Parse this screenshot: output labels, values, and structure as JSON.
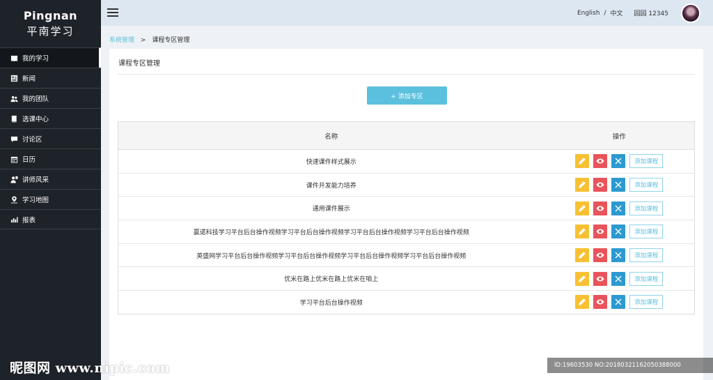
{
  "app": {
    "brand": "Pingnan",
    "brand_sub": "平南学习"
  },
  "sidebar": {
    "items": [
      {
        "label": "我的学习",
        "icon": "book-icon"
      },
      {
        "label": "新闻",
        "icon": "newspaper-icon"
      },
      {
        "label": "我的团队",
        "icon": "team-icon"
      },
      {
        "label": "选课中心",
        "icon": "book-icon"
      },
      {
        "label": "讨论区",
        "icon": "chat-icon"
      },
      {
        "label": "日历",
        "icon": "calendar-icon"
      },
      {
        "label": "讲师风采",
        "icon": "teacher-icon"
      },
      {
        "label": "学习地图",
        "icon": "map-pin-icon"
      },
      {
        "label": "报表",
        "icon": "bar-chart-icon"
      }
    ]
  },
  "header": {
    "lang_en": "English",
    "lang_sep": "/",
    "lang_zh": "中文",
    "user": "园园 12345"
  },
  "breadcrumb": {
    "parent": "系统管理",
    "separator": ">",
    "current": "课程专区管理"
  },
  "panel": {
    "title": "课程专区管理",
    "add_button": "+ 添加专区"
  },
  "table": {
    "headers": {
      "name": "名称",
      "ops": "操作"
    },
    "add_course_label": "添加课程",
    "rows": [
      {
        "name": "快速课件样式展示"
      },
      {
        "name": "课件开发能力培养"
      },
      {
        "name": "通用课件展示"
      },
      {
        "name": "赢诺科技学习平台后台操作视频学习平台后台操作视频学习平台后台操作视频学习平台后台操作视频"
      },
      {
        "name": "英盛网学习平台后台操作视频学习平台后台操作视频学习平台后台操作视频学习平台后台操作视频"
      },
      {
        "name": "优米在路上优米在路上优米在咱上"
      },
      {
        "name": "学习平台后台操作视频"
      }
    ]
  },
  "colors": {
    "sidebar_bg": "#1e2329",
    "header_bg": "#dde7f1",
    "accent": "#5bc0de",
    "edit": "#f8c032",
    "view": "#e9545a",
    "delete": "#2c9ad0"
  },
  "watermark": {
    "left": "昵图网 www.nipic.com",
    "right": "ID:19603530 NO:20180321162050388000"
  }
}
